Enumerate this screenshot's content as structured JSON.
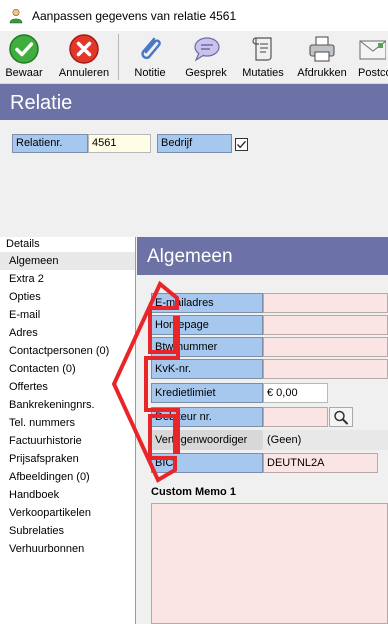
{
  "window": {
    "title": "Aanpassen gegevens van relatie 4561"
  },
  "toolbar": {
    "buttons": [
      {
        "label": "Bewaar",
        "icon": "check-icon"
      },
      {
        "label": "Annuleren",
        "icon": "cancel-icon"
      },
      {
        "label": "Notitie",
        "icon": "paperclip-icon"
      },
      {
        "label": "Gesprek",
        "icon": "speech-bubble-icon"
      },
      {
        "label": "Mutaties",
        "icon": "scroll-icon"
      },
      {
        "label": "Afdrukken",
        "icon": "printer-icon"
      },
      {
        "label": "Postco",
        "icon": "envelope-icon"
      }
    ]
  },
  "relatie": {
    "heading": "Relatie",
    "relatienr_label": "Relatienr.",
    "relatienr_value": "4561",
    "bedrijf_label": "Bedrijf",
    "bedrijf_checked": true
  },
  "tree": {
    "header": "Details",
    "items": [
      "Algemeen",
      "Extra 2",
      "Opties",
      "E-mail",
      "Adres",
      "Contactpersonen (0)",
      "Contacten (0)",
      "Offertes",
      "Bankrekeningnrs.",
      "Tel. nummers",
      "Factuurhistorie",
      "Prijsafspraken",
      "Afbeeldingen (0)",
      "Handboek",
      "Verkoopartikelen",
      "Subrelaties",
      "Verhuurbonnen"
    ],
    "selected": "Algemeen"
  },
  "algemeen": {
    "heading": "Algemeen",
    "fields": [
      {
        "label": "E-mailadres",
        "value": ""
      },
      {
        "label": "Homepage",
        "value": ""
      },
      {
        "label": "Btw-nummer",
        "value": ""
      },
      {
        "label": "KvK-nr.",
        "value": ""
      },
      {
        "label": "Kredietlimiet",
        "value": "€ 0,00"
      },
      {
        "label": "Debiteur nr.",
        "value": ""
      },
      {
        "label": "Vertegenwoordiger",
        "value": "(Geen)"
      },
      {
        "label": "BIC",
        "value": "DEUTNL2A"
      }
    ],
    "memo_title": "Custom Memo 1"
  },
  "colors": {
    "header_band": "#6d72a6",
    "label_blue": "#a7c8ee",
    "field_pink": "#fbe4e4",
    "annotation_red": "#e8262a"
  }
}
